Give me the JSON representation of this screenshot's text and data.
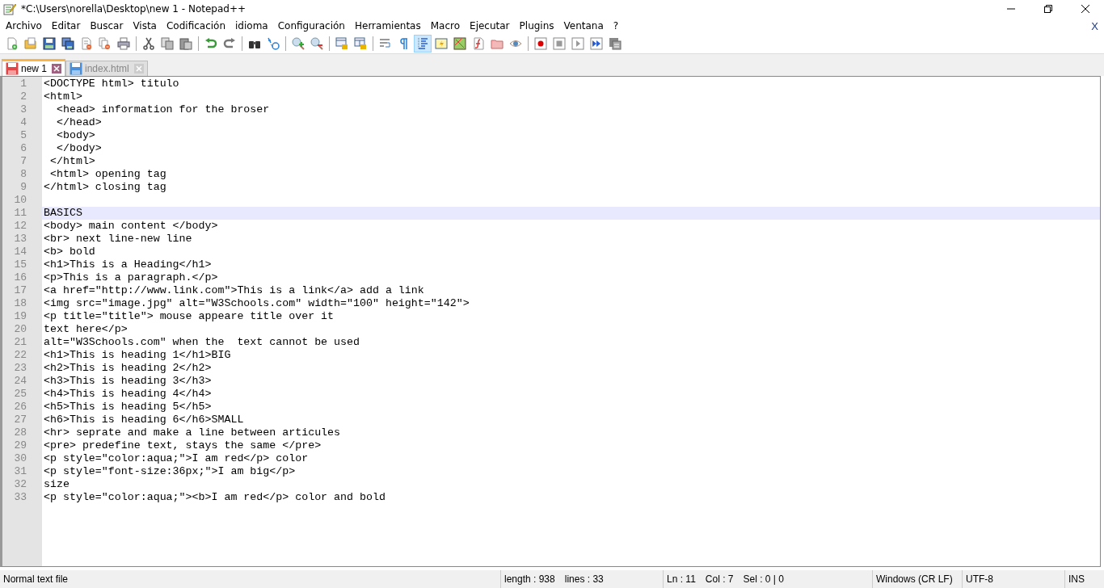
{
  "window": {
    "title": "*C:\\Users\\norella\\Desktop\\new 1 - Notepad++"
  },
  "menu": [
    "Archivo",
    "Editar",
    "Buscar",
    "Vista",
    "Codificación",
    "idioma",
    "Configuración",
    "Herramientas",
    "Macro",
    "Ejecutar",
    "Plugins",
    "Ventana",
    "?"
  ],
  "menu_close": "X",
  "toolbar": [
    {
      "kind": "new"
    },
    {
      "kind": "open"
    },
    {
      "kind": "save"
    },
    {
      "kind": "saveall"
    },
    {
      "kind": "close"
    },
    {
      "kind": "closeall"
    },
    {
      "kind": "print"
    },
    {
      "kind": "sep"
    },
    {
      "kind": "cut"
    },
    {
      "kind": "copy"
    },
    {
      "kind": "paste"
    },
    {
      "kind": "sep"
    },
    {
      "kind": "undo"
    },
    {
      "kind": "redo"
    },
    {
      "kind": "sep"
    },
    {
      "kind": "find"
    },
    {
      "kind": "replace"
    },
    {
      "kind": "sep"
    },
    {
      "kind": "zoomin"
    },
    {
      "kind": "zoomout"
    },
    {
      "kind": "sep"
    },
    {
      "kind": "syncv"
    },
    {
      "kind": "synch"
    },
    {
      "kind": "sep"
    },
    {
      "kind": "wrap",
      "on": false
    },
    {
      "kind": "allchars",
      "on": false
    },
    {
      "kind": "indent",
      "on": true
    },
    {
      "kind": "udl",
      "on": false
    },
    {
      "kind": "docmap",
      "on": false
    },
    {
      "kind": "funclist",
      "on": false
    },
    {
      "kind": "folder",
      "on": false
    },
    {
      "kind": "monitor",
      "on": false
    },
    {
      "kind": "sep"
    },
    {
      "kind": "record"
    },
    {
      "kind": "stop"
    },
    {
      "kind": "play"
    },
    {
      "kind": "playmulti"
    },
    {
      "kind": "savemacro"
    }
  ],
  "tabs": [
    {
      "label": "new 1",
      "selected": true,
      "modified": true
    },
    {
      "label": "index.html",
      "selected": false,
      "modified": false
    }
  ],
  "editor": {
    "lines": [
      {
        "number": "1",
        "text": "<DOCTYPE html> titulo",
        "current": false
      },
      {
        "number": "2",
        "text": "<html>",
        "current": false
      },
      {
        "number": "3",
        "text": "  <head> information for the broser",
        "current": false
      },
      {
        "number": "4",
        "text": "  </head>",
        "current": false
      },
      {
        "number": "5",
        "text": "  <body>",
        "current": false
      },
      {
        "number": "6",
        "text": "  </body>",
        "current": false
      },
      {
        "number": "7",
        "text": " </html>",
        "current": false
      },
      {
        "number": "8",
        "text": " <html> opening tag",
        "current": false
      },
      {
        "number": "9",
        "text": "</html> closing tag",
        "current": false
      },
      {
        "number": "10",
        "current": false
      },
      {
        "number": "11",
        "text": "BASICS",
        "current": true
      },
      {
        "number": "12",
        "text": "<body> main content </body>",
        "current": false
      },
      {
        "number": "13",
        "text": "<br> next line-new line",
        "current": false
      },
      {
        "number": "14",
        "text": "<b> bold",
        "current": false
      },
      {
        "number": "15",
        "text": "<h1>This is a Heading</h1>",
        "current": false
      },
      {
        "number": "16",
        "text": "<p>This is a paragraph.</p>",
        "current": false
      },
      {
        "number": "17",
        "text": "<a href=\"http://www.link.com\">This is a link</a> add a link",
        "current": false
      },
      {
        "number": "18",
        "text": "<img src=\"image.jpg\" alt=\"W3Schools.com\" width=\"100\" height=\"142\">",
        "current": false
      },
      {
        "number": "19",
        "text": "<p title=\"title\"> mouse appeare title over it",
        "current": false
      },
      {
        "number": "20",
        "text": "text here</p>",
        "current": false
      },
      {
        "number": "21",
        "text": "alt=\"W3Schools.com\" when the  text cannot be used",
        "current": false
      },
      {
        "number": "22",
        "text": "<h1>This is heading 1</h1>BIG",
        "current": false
      },
      {
        "number": "23",
        "text": "<h2>This is heading 2</h2>",
        "current": false
      },
      {
        "number": "24",
        "text": "<h3>This is heading 3</h3>",
        "current": false
      },
      {
        "number": "25",
        "text": "<h4>This is heading 4</h4>",
        "current": false
      },
      {
        "number": "26",
        "text": "<h5>This is heading 5</h5>",
        "current": false
      },
      {
        "number": "27",
        "text": "<h6>This is heading 6</h6>SMALL",
        "current": false
      },
      {
        "number": "28",
        "text": "<hr> seprate and make a line between articules",
        "current": false
      },
      {
        "number": "29",
        "text": "<pre> predefine text, stays the same </pre>",
        "current": false
      },
      {
        "number": "30",
        "text": "<p style=\"color:aqua;\">I am red</p> color",
        "current": false
      },
      {
        "number": "31",
        "text": "<p style=\"font-size:36px;\">I am big</p>",
        "current": false
      },
      {
        "number": "32",
        "text": "size",
        "current": false
      },
      {
        "number": "33",
        "text": "<p style=\"color:aqua;\"><b>I am red</p> color and bold",
        "current": false
      }
    ]
  },
  "status_bar": {
    "file_type": "Normal text file",
    "length": "length : 938",
    "lines": "lines : 33",
    "ln": "Ln : 11",
    "col": "Col : 7",
    "sel": "Sel : 0 | 0",
    "eol": "Windows (CR LF)",
    "encoding": "UTF-8",
    "mode": "INS"
  }
}
